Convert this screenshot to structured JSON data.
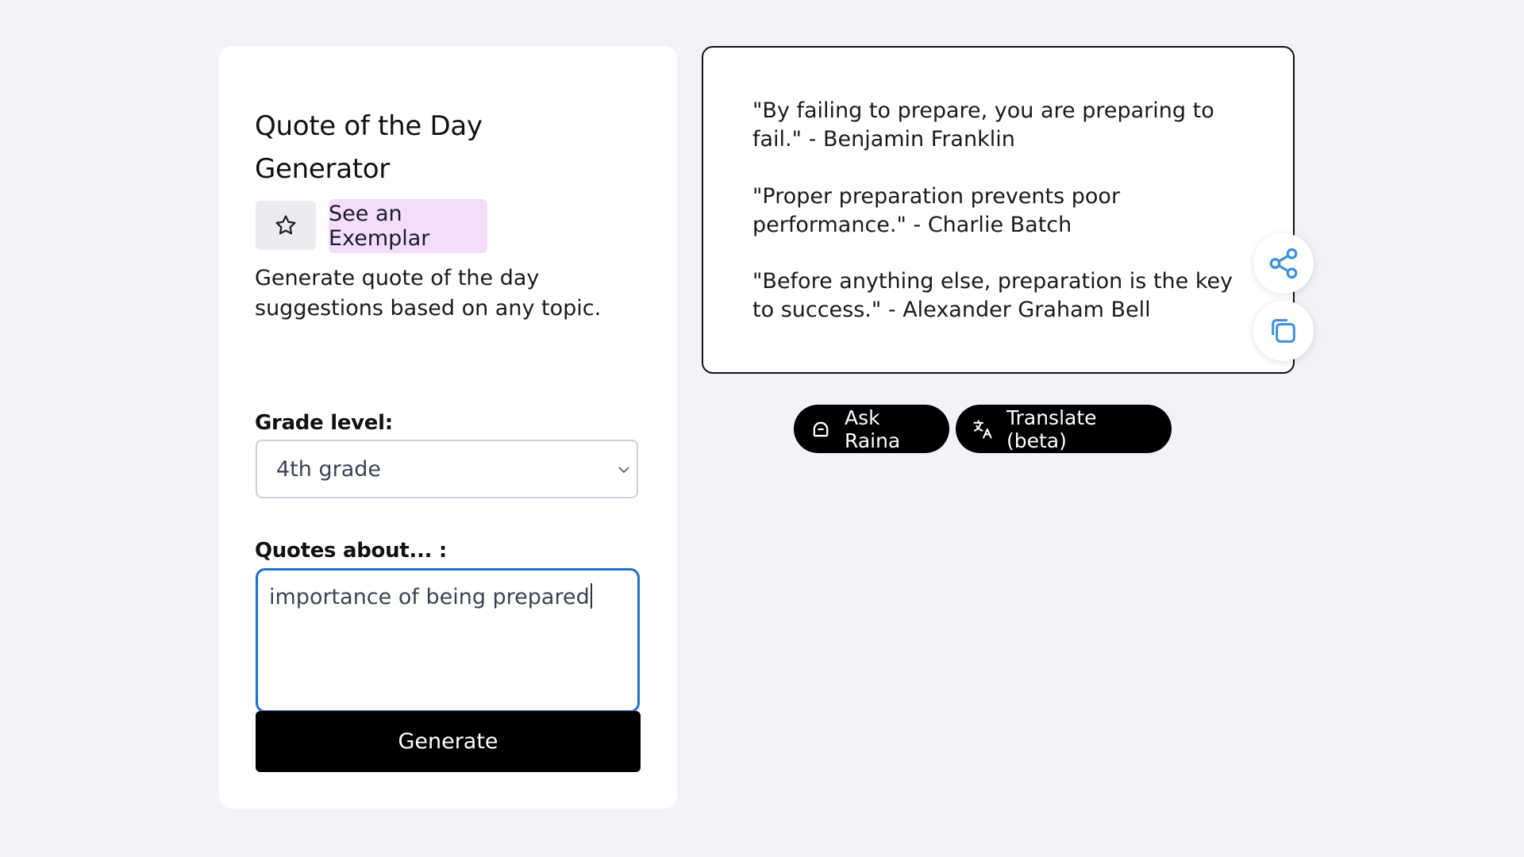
{
  "form": {
    "title": "Quote of the Day Generator",
    "exemplar_label": "See an Exemplar",
    "description": "Generate quote of the day suggestions based on any topic.",
    "grade_label": "Grade level:",
    "grade_value": "4th grade",
    "quotes_label": "Quotes about... :",
    "quotes_value": "importance of being prepared",
    "generate_label": "Generate"
  },
  "output": {
    "quotes": [
      "\"By failing to prepare, you are preparing to fail.\" - Benjamin Franklin",
      "\"Proper preparation prevents poor performance.\" - Charlie Batch",
      "\"Before anything else, preparation is the key to success.\" - Alexander Graham Bell"
    ]
  },
  "actions": {
    "ask_label": "Ask Raina",
    "translate_label": "Translate (beta)"
  },
  "icons": {
    "favorite": "star-icon",
    "share": "share-icon",
    "copy": "copy-icon",
    "ask": "raina-icon",
    "translate": "translate-icon",
    "dropdown": "chevron-down-icon"
  },
  "colors": {
    "background": "#f2f3f7",
    "exemplar_bg": "#f4dcfb",
    "focus_border": "#1f6fd1",
    "icon_blue": "#3b8fe0",
    "primary_button": "#000000"
  }
}
